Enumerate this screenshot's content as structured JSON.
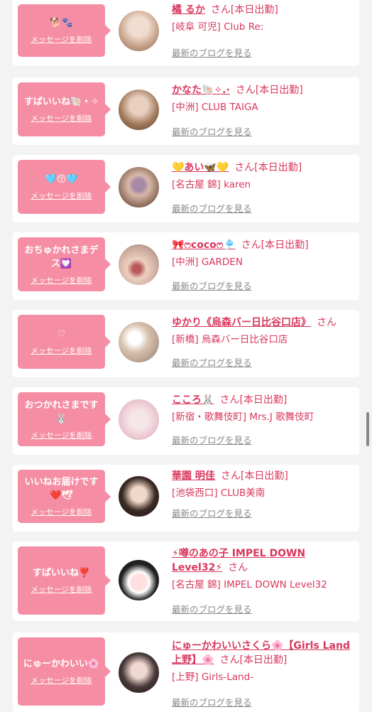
{
  "delete_label": "メッセージを削除",
  "blog_label": "最新のブログを見る",
  "san_label": "さん",
  "cards": [
    {
      "message": "🐕🐾",
      "name": "橘 るか",
      "status": "[本日出勤]",
      "shop": "[岐阜 可児] Club Re:",
      "avatar_color": "#d8b9a8"
    },
    {
      "message": "すばいいね🐚・✧",
      "name": "かなた🐚✧.·",
      "status": "[本日出勤]",
      "shop": "[中洲] CLUB TAIGA",
      "avatar_color": "#b08a6a"
    },
    {
      "message": "🩵😚🩵",
      "name": "💛あい🦋💛",
      "status": "[本日出勤]",
      "shop": "[名古屋 錦] karen",
      "avatar_color": "#8b6b5a"
    },
    {
      "message": "おちゅかれさまデス💟",
      "name": "🎀ෆcocoෆ🎐",
      "status": "[本日出勤]",
      "shop": "[中洲] GARDEN",
      "avatar_color": "#c9a79a"
    },
    {
      "message": "♡",
      "name": "ゆかり《烏森バー日比谷口店》",
      "status": "",
      "shop": "[新橋] 烏森バー日比谷口店",
      "avatar_color": "#d9c4b0"
    },
    {
      "message": "おつかれさまです🐰",
      "name": "こころ🐰",
      "status": "[本日出勤]",
      "shop": "[新宿・歌舞伎町] Mrs.J 歌舞伎町",
      "avatar_color": "#eecbd4"
    },
    {
      "message": "いいねお届けです❤️🕊",
      "name": "華園 明佳",
      "status": "[本日出勤]",
      "shop": "[池袋西口] CLUB美南",
      "avatar_color": "#3a2a24"
    },
    {
      "message": "すばいいね❣️",
      "name": "⚡噂のあの子 IMPEL DOWN Level32⚡",
      "status": "",
      "shop": "[名古屋 錦] IMPEL DOWN Level32",
      "avatar_color": "#222222"
    },
    {
      "message": "にゅーかわいい🌸",
      "name": "にゅーかわいいさくら🌸【Girls Land上野】🌸",
      "status": "[本日出勤]",
      "shop": "[上野] Girls-Land-",
      "avatar_color": "#4a3a3a"
    }
  ]
}
